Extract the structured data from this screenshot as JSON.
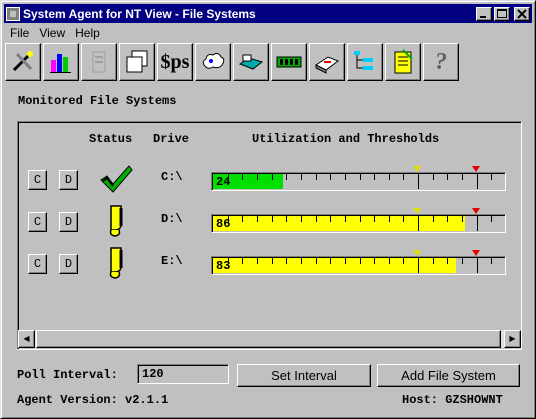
{
  "window": {
    "title": "System Agent for NT View - File Systems"
  },
  "menu": [
    "File",
    "View",
    "Help"
  ],
  "toolbar": [
    {
      "name": "tools-icon"
    },
    {
      "name": "chart-icon"
    },
    {
      "name": "disabled-icon"
    },
    {
      "name": "windows-icon"
    },
    {
      "name": "sps-icon",
      "label": "$ps"
    },
    {
      "name": "cloud-icon"
    },
    {
      "name": "network-icon"
    },
    {
      "name": "memory-icon"
    },
    {
      "name": "disk-icon"
    },
    {
      "name": "tree-icon"
    },
    {
      "name": "notepad-icon"
    },
    {
      "name": "help-icon",
      "label": "?"
    }
  ],
  "panel": {
    "title": "Monitored File Systems",
    "headers": {
      "status": "Status",
      "drive": "Drive",
      "util": "Utilization and Thresholds"
    }
  },
  "rows": [
    {
      "c_label": "C",
      "d_label": "D",
      "drive": "C:\\",
      "status": "ok",
      "value": "24",
      "percent": 24,
      "fill": "#00e000"
    },
    {
      "c_label": "C",
      "d_label": "D",
      "drive": "D:\\",
      "status": "warn",
      "value": "86",
      "percent": 86,
      "fill": "#ffff00"
    },
    {
      "c_label": "C",
      "d_label": "D",
      "drive": "E:\\",
      "status": "warn",
      "value": "83",
      "percent": 83,
      "fill": "#ffff00"
    }
  ],
  "thresholds": {
    "warning_percent": 70,
    "critical_percent": 90,
    "warning_color": "#e0e000",
    "critical_color": "#e00000"
  },
  "bottom": {
    "poll_label": "Poll Interval:",
    "poll_value": "120",
    "set_interval": "Set Interval",
    "add_fs": "Add File System",
    "version": "Agent Version: v2.1.1",
    "host": "Host:  GZSHOWNT"
  }
}
